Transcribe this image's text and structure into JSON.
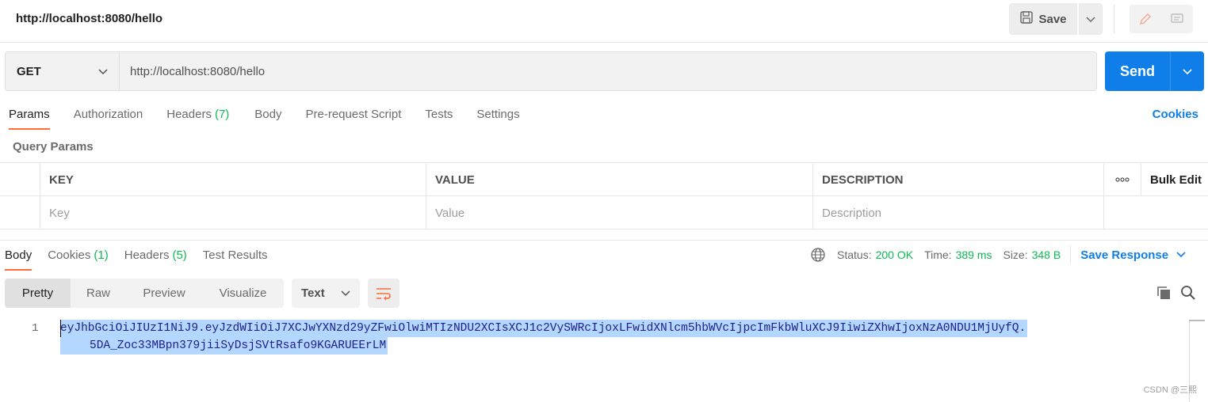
{
  "request": {
    "title": "http://localhost:8080/hello",
    "save_label": "Save",
    "method": "GET",
    "url": "http://localhost:8080/hello",
    "send_label": "Send"
  },
  "request_tabs": {
    "params": "Params",
    "authorization": "Authorization",
    "headers": "Headers",
    "headers_count": "(7)",
    "body": "Body",
    "prerequest": "Pre-request Script",
    "tests": "Tests",
    "settings": "Settings",
    "cookies": "Cookies"
  },
  "query_params": {
    "title": "Query Params",
    "columns": {
      "key": "KEY",
      "value": "VALUE",
      "description": "DESCRIPTION",
      "more": "ooo",
      "bulk_edit": "Bulk Edit"
    },
    "placeholders": {
      "key": "Key",
      "value": "Value",
      "description": "Description"
    }
  },
  "response": {
    "tabs": {
      "body": "Body",
      "cookies": "Cookies",
      "cookies_count": "(1)",
      "headers": "Headers",
      "headers_count": "(5)",
      "test_results": "Test Results"
    },
    "status_label": "Status:",
    "status_value": "200 OK",
    "time_label": "Time:",
    "time_value": "389 ms",
    "size_label": "Size:",
    "size_value": "348 B",
    "save_response": "Save Response",
    "views": {
      "pretty": "Pretty",
      "raw": "Raw",
      "preview": "Preview",
      "visualize": "Visualize"
    },
    "format": "Text",
    "line_number": "1",
    "body_line1": "eyJhbGciOiJIUzI1NiJ9.eyJzdWIiOiJ7XCJwYXNzd29yZFwiOlwiMTIzNDU2XCIsXCJ1c2VySWRcIjoxLFwidXNlcm5hbWVcIjpcImFkbWluXCJ9IiwiZXhwIjoxNzA0NDU1MjUyfQ.",
    "body_line2": "5DA_Zoc33MBpn379jiiSyDsjSVtRsafo9KGARUEErLM"
  },
  "watermark": "CSDN @三熙",
  "colors": {
    "accent": "#0f7ee8",
    "tab_underline": "#ff6c37",
    "count_green": "#0cbb52",
    "selection": "#b3d7fe"
  }
}
